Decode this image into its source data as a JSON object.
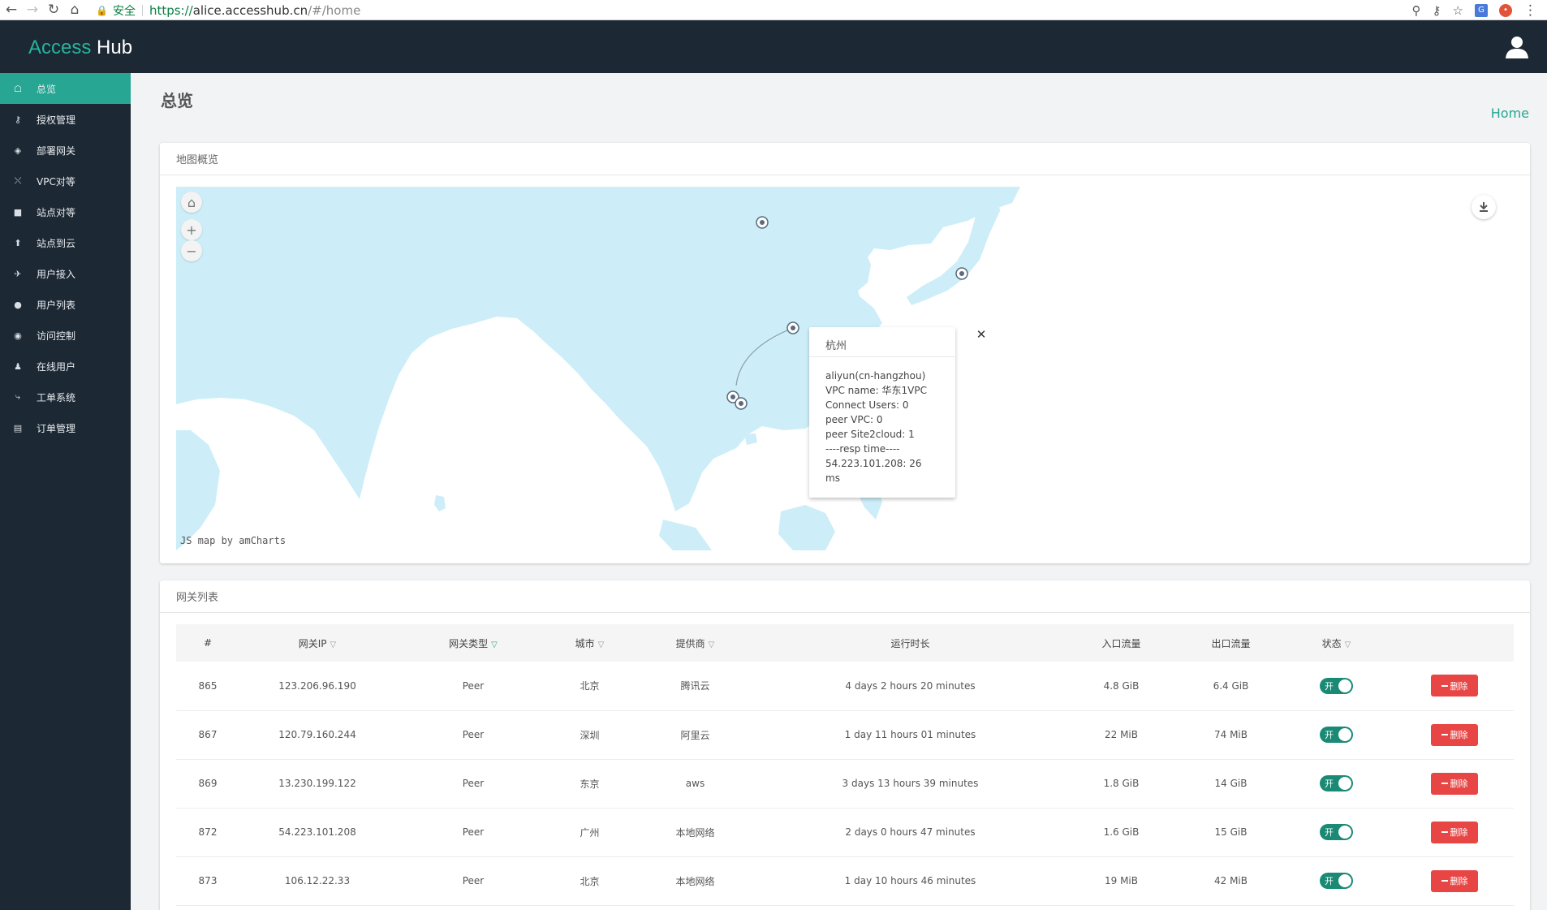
{
  "browser": {
    "secure_label": "安全",
    "url_scheme": "https://",
    "url_host": "alice.accesshub.cn",
    "url_path": "/#/home"
  },
  "app": {
    "brand_first": "Access",
    "brand_second": "Hub"
  },
  "sidebar": {
    "items": [
      {
        "label": "总览",
        "icon": "home-icon",
        "active": true
      },
      {
        "label": "授权管理",
        "icon": "key-icon"
      },
      {
        "label": "部署网关",
        "icon": "cube-icon"
      },
      {
        "label": "VPC对等",
        "icon": "shuffle-icon"
      },
      {
        "label": "站点对等",
        "icon": "sitemap-icon"
      },
      {
        "label": "站点到云",
        "icon": "upload-icon"
      },
      {
        "label": "用户接入",
        "icon": "plane-icon"
      },
      {
        "label": "用户列表",
        "icon": "users-icon"
      },
      {
        "label": "访问控制",
        "icon": "circle-dot-icon"
      },
      {
        "label": "在线用户",
        "icon": "user-icon"
      },
      {
        "label": "工单系统",
        "icon": "wrench-icon"
      },
      {
        "label": "订单管理",
        "icon": "cart-icon"
      }
    ]
  },
  "page": {
    "title": "总览",
    "breadcrumb": "Home"
  },
  "map_card": {
    "title": "地图概览",
    "credit": "JS map by amCharts",
    "popup": {
      "title": "杭州",
      "lines": [
        "aliyun(cn-hangzhou)",
        "VPC name: 华东1VPC",
        "Connect Users: 0",
        "peer VPC: 0",
        "peer Site2cloud: 1",
        "----resp time----",
        "54.223.101.208: 26 ms"
      ]
    }
  },
  "gateway_card": {
    "title": "网关列表",
    "columns": [
      "#",
      "网关IP",
      "网关类型",
      "城市",
      "提供商",
      "运行时长",
      "入口流量",
      "出口流量",
      "状态",
      ""
    ],
    "filter_columns": [
      1,
      2,
      3,
      4,
      8
    ],
    "active_filter_column": 2,
    "rows": [
      {
        "id": "865",
        "ip": "123.206.96.190",
        "type": "Peer",
        "city": "北京",
        "provider": "腾讯云",
        "uptime": "4 days 2 hours 20 minutes",
        "in": "4.8 GiB",
        "out": "6.4 GiB",
        "status": "开",
        "action": "删除"
      },
      {
        "id": "867",
        "ip": "120.79.160.244",
        "type": "Peer",
        "city": "深圳",
        "provider": "阿里云",
        "uptime": "1 day 11 hours 01 minutes",
        "in": "22 MiB",
        "out": "74 MiB",
        "status": "开",
        "action": "删除"
      },
      {
        "id": "869",
        "ip": "13.230.199.122",
        "type": "Peer",
        "city": "东京",
        "provider": "aws",
        "uptime": "3 days 13 hours 39 minutes",
        "in": "1.8 GiB",
        "out": "14 GiB",
        "status": "开",
        "action": "删除"
      },
      {
        "id": "872",
        "ip": "54.223.101.208",
        "type": "Peer",
        "city": "广州",
        "provider": "本地网络",
        "uptime": "2 days 0 hours 47 minutes",
        "in": "1.6 GiB",
        "out": "15 GiB",
        "status": "开",
        "action": "删除"
      },
      {
        "id": "873",
        "ip": "106.12.22.33",
        "type": "Peer",
        "city": "北京",
        "provider": "本地网络",
        "uptime": "1 day 10 hours 46 minutes",
        "in": "19 MiB",
        "out": "42 MiB",
        "status": "开",
        "action": "删除"
      }
    ]
  },
  "colors": {
    "accent": "#26a693",
    "dark": "#1c2834",
    "danger": "#e84545",
    "map_land": "#cdeef8"
  }
}
